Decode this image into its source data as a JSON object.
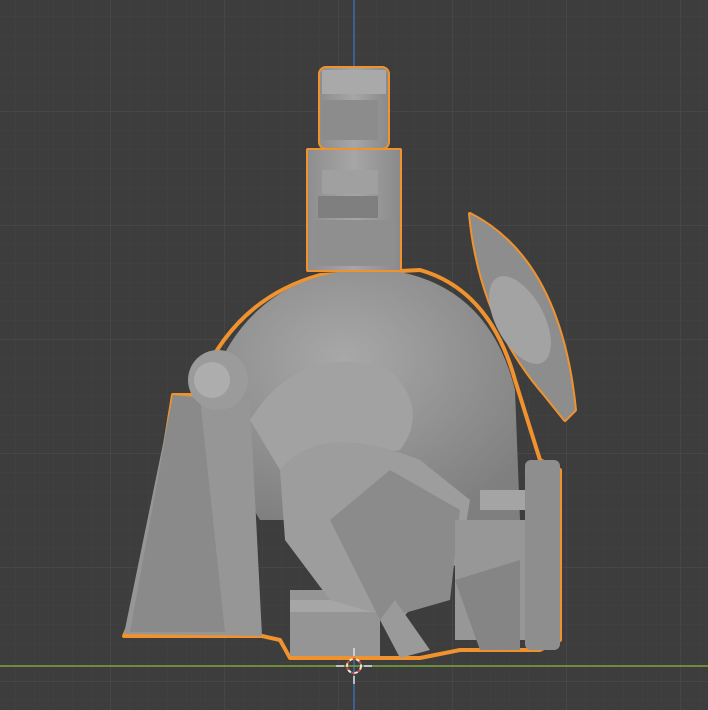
{
  "viewport": {
    "background": "#3d3d3d",
    "grid_minor": "#434343",
    "grid_major": "#4a4a4a",
    "x_axis_color": "#7ea33a",
    "z_axis_color": "#3a6ea8",
    "selection_outline": "#f0922d",
    "model_fill": "#9a9a9a",
    "cursor_icon": "3d-cursor-icon"
  }
}
